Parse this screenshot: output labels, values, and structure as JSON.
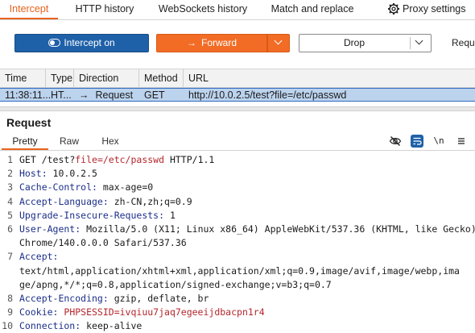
{
  "tabs": [
    {
      "label": "Intercept"
    },
    {
      "label": "HTTP history"
    },
    {
      "label": "WebSockets history"
    },
    {
      "label": "Match and replace"
    },
    {
      "label": "Proxy settings"
    }
  ],
  "toolbar": {
    "intercept_label": "Intercept on",
    "forward_label": "Forward",
    "drop_label": "Drop",
    "request_clipped": "Requ"
  },
  "history": {
    "columns": [
      "Time",
      "Type",
      "Direction",
      "Method",
      "URL"
    ],
    "rows": [
      {
        "time": "11:38:11...",
        "type": "HT...",
        "direction": "Request",
        "method": "GET",
        "url": "http://10.0.2.5/test?file=/etc/passwd"
      }
    ]
  },
  "request": {
    "title": "Request",
    "view_tabs": [
      "Pretty",
      "Raw",
      "Hex"
    ],
    "newline_toggle": "\\n",
    "lines": [
      {
        "num": "1",
        "k": "GET ",
        "v": "/test?",
        "p": "file=/etc/passwd",
        "rest": " HTTP/1.1"
      },
      {
        "num": "2",
        "k": "Host:",
        "v": " 10.0.2.5"
      },
      {
        "num": "3",
        "k": "Cache-Control:",
        "v": " max-age=0"
      },
      {
        "num": "4",
        "k": "Accept-Language:",
        "v": " zh-CN,zh;q=0.9"
      },
      {
        "num": "5",
        "k": "Upgrade-Insecure-Requests:",
        "v": " 1"
      },
      {
        "num": "6",
        "k": "User-Agent:",
        "v": " Mozilla/5.0 (X11; Linux x86_64) AppleWebKit/537.36 (KHTML, like Gecko)"
      },
      {
        "num": "",
        "k": "",
        "v": "Chrome/140.0.0.0 Safari/537.36"
      },
      {
        "num": "7",
        "k": "Accept:",
        "v": ""
      },
      {
        "num": "",
        "k": "",
        "v": "text/html,application/xhtml+xml,application/xml;q=0.9,image/avif,image/webp,ima"
      },
      {
        "num": "",
        "k": "",
        "v": "ge/apng,*/*;q=0.8,application/signed-exchange;v=b3;q=0.7"
      },
      {
        "num": "8",
        "k": "Accept-Encoding:",
        "v": " gzip, deflate, br"
      },
      {
        "num": "9",
        "k": "Cookie:",
        "p": " PHPSESSID=ivqiuu7jaq7egeeijdbacpn1r4",
        "v": ""
      },
      {
        "num": "10",
        "k": "Connection:",
        "v": " keep-alive"
      }
    ]
  },
  "colors": {
    "accent": "#e8631e",
    "primary": "#1f61a8",
    "selection": "#bcd3ee",
    "param": "#b4262c",
    "header_key": "#1c2f8a"
  },
  "icons": [
    "gear-icon",
    "toggle-icon",
    "arrow-right-icon",
    "chevron-down-icon",
    "eye-off-icon",
    "wrap-text-icon",
    "menu-icon"
  ]
}
